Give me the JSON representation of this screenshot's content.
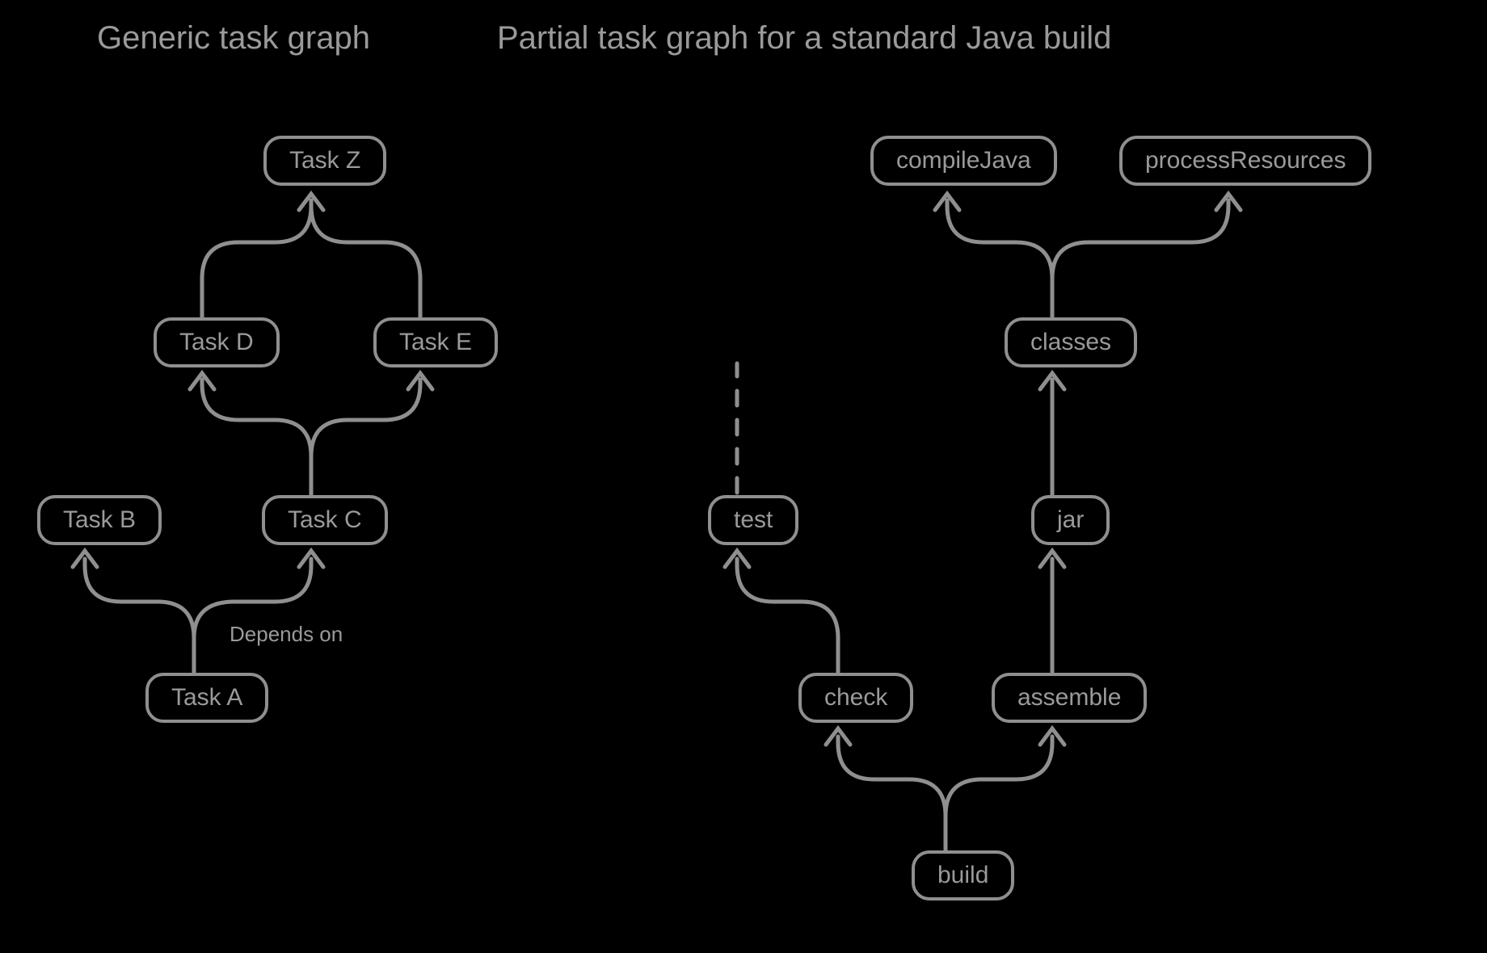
{
  "titles": {
    "left": "Generic task graph",
    "right": "Partial task graph for a standard Java build"
  },
  "nodes": {
    "taskZ": "Task Z",
    "taskD": "Task D",
    "taskE": "Task E",
    "taskB": "Task B",
    "taskC": "Task C",
    "taskA": "Task A",
    "compileJava": "compileJava",
    "processResources": "processResources",
    "classes": "classes",
    "test": "test",
    "jar": "jar",
    "check": "check",
    "assemble": "assemble",
    "build": "build"
  },
  "labels": {
    "dependsOn": "Depends on"
  },
  "colors": {
    "stroke": "#8f8f8f",
    "text": "#9a9a9a"
  },
  "diagram": {
    "type": "task_dependency_graph",
    "graphs": [
      {
        "title_key": "titles.left",
        "edges": [
          {
            "from": "taskA",
            "to": "taskB",
            "label_key": "labels.dependsOn"
          },
          {
            "from": "taskA",
            "to": "taskC"
          },
          {
            "from": "taskC",
            "to": "taskD"
          },
          {
            "from": "taskC",
            "to": "taskE"
          },
          {
            "from": "taskD",
            "to": "taskZ"
          },
          {
            "from": "taskE",
            "to": "taskZ"
          }
        ]
      },
      {
        "title_key": "titles.right",
        "edges": [
          {
            "from": "build",
            "to": "check"
          },
          {
            "from": "build",
            "to": "assemble"
          },
          {
            "from": "check",
            "to": "test"
          },
          {
            "from": "assemble",
            "to": "jar"
          },
          {
            "from": "jar",
            "to": "classes"
          },
          {
            "from": "classes",
            "to": "compileJava"
          },
          {
            "from": "classes",
            "to": "processResources"
          },
          {
            "from": "test",
            "to": null,
            "style": "dashed",
            "note": "continues to further tasks (not shown)"
          }
        ]
      }
    ]
  }
}
